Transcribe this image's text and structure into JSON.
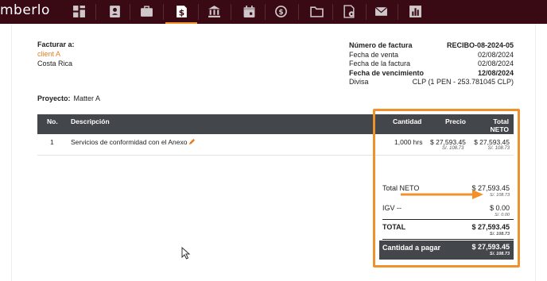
{
  "app": {
    "brand": "mberlo"
  },
  "nav": {
    "icons": [
      "grid-icon",
      "contacts-icon",
      "briefcase-icon",
      "invoice-dollar-icon",
      "bank-icon",
      "calendar-icon",
      "time-money-icon",
      "folder-icon",
      "document-settings-icon",
      "mail-icon",
      "report-chart-icon"
    ],
    "active": "invoice-dollar-icon",
    "colors": {
      "bar": "#3a0a14",
      "accent": "#f0922b"
    }
  },
  "bill_to": {
    "label": "Facturar a:",
    "client": "client A",
    "country": "Costa Rica"
  },
  "meta": [
    {
      "label": "Número de factura",
      "value": "RECIBO-08-2024-05",
      "bold": true
    },
    {
      "label": "Fecha de venta",
      "value": "02/08/2024",
      "bold": false
    },
    {
      "label": "Fecha de la factura",
      "value": "02/08/2024",
      "bold": false
    },
    {
      "label": "Fecha de vencimiento",
      "value": "12/08/2024",
      "bold": true
    },
    {
      "label": "Divisa",
      "value": "CLP (1 PEN - 253.781045 CLP)",
      "bold": false
    }
  ],
  "project": {
    "label": "Proyecto:",
    "value": "Matter A"
  },
  "table": {
    "headers": {
      "no": "No.",
      "desc": "Descripción",
      "qty": "Cantidad",
      "price": "Precio",
      "total_line1": "Total",
      "total_line2": "NETO"
    },
    "rows": [
      {
        "no": "1",
        "desc": "Servicios de conformidad con el Anexo",
        "qty": "1,000 hrs",
        "price": "$ 27,593.45",
        "price_sub": "S/. 108.73",
        "total": "$ 27,593.45",
        "total_sub": "S/. 108.73"
      }
    ]
  },
  "totals": {
    "neto": {
      "label": "Total NETO",
      "value": "$ 27,593.45",
      "sub": "S/. 108.73"
    },
    "igv": {
      "label": "IGV --",
      "value": "$ 0.00",
      "sub": "S/. 0.00"
    },
    "total": {
      "label": "TOTAL",
      "value": "$ 27,593.45",
      "sub": "S/. 108.73"
    },
    "pay": {
      "label": "Cantidad a pagar",
      "value": "$ 27,593.45",
      "sub": "S/. 108.73"
    }
  }
}
